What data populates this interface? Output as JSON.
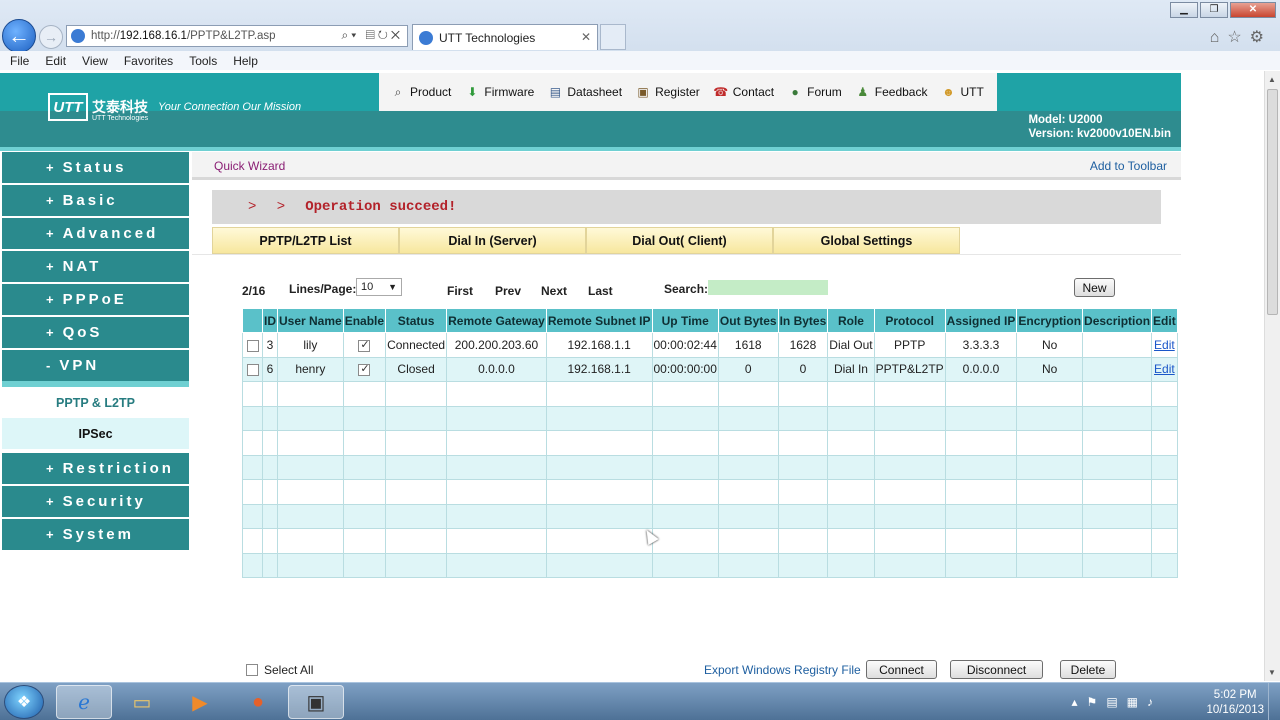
{
  "browser": {
    "url_prefix": "http://",
    "url_host": "192.168.16.1",
    "url_path": "/PPTP&L2TP.asp",
    "tab_title": "UTT Technologies",
    "menu": [
      "File",
      "Edit",
      "View",
      "Favorites",
      "Tools",
      "Help"
    ]
  },
  "header": {
    "logo_mark": "UTT",
    "logo_cn": "艾泰科技",
    "logo_slogan": "Your Connection  Our Mission",
    "logo_sub": "UTT Technologies",
    "toolbar": [
      "Product",
      "Firmware",
      "Datasheet",
      "Register",
      "Contact",
      "Forum",
      "Feedback",
      "UTT"
    ],
    "model": "Model: U2000",
    "version": "Version: kv2000v10EN.bin"
  },
  "sidebar": {
    "items_top": [
      {
        "sign": "+",
        "label": "Status"
      },
      {
        "sign": "+",
        "label": "Basic"
      },
      {
        "sign": "+",
        "label": "Advanced"
      },
      {
        "sign": "+",
        "label": "NAT"
      },
      {
        "sign": "+",
        "label": "PPPoE"
      },
      {
        "sign": "+",
        "label": "QoS"
      },
      {
        "sign": "-",
        "label": "VPN"
      }
    ],
    "sub_items": [
      "PPTP & L2TP",
      "IPSec"
    ],
    "items_bottom": [
      {
        "sign": "+",
        "label": "Restriction"
      },
      {
        "sign": "+",
        "label": "Security"
      },
      {
        "sign": "+",
        "label": "System"
      }
    ]
  },
  "quickbar": {
    "left": "Quick Wizard",
    "right": "Add to Toolbar"
  },
  "message": {
    "arrows": "> >",
    "text": "Operation succeed!"
  },
  "tabs": [
    "PPTP/L2TP List",
    "Dial In (Server)",
    "Dial Out( Client)",
    "Global Settings"
  ],
  "pager": {
    "count": "2/16",
    "lines_label": "Lines/Page:",
    "lines_value": "10",
    "first": "First",
    "prev": "Prev",
    "next": "Next",
    "last": "Last",
    "search_label": "Search:",
    "new_label": "New"
  },
  "table": {
    "columns": [
      "ID",
      "User Name",
      "Enable",
      "Status",
      "Remote Gateway",
      "Remote Subnet IP",
      "Up Time",
      "Out Bytes",
      "In Bytes",
      "Role",
      "Protocol",
      "Assigned IP",
      "Encryption",
      "Description",
      "Edit"
    ],
    "rows": [
      {
        "id": "3",
        "user": "lily",
        "enabled": true,
        "status": "Connected",
        "gateway": "200.200.203.60",
        "subnet": "192.168.1.1",
        "uptime": "00:00:02:44",
        "out": "1618",
        "in": "1628",
        "role": "Dial Out",
        "protocol": "PPTP",
        "assigned": "3.3.3.3",
        "encryption": "No",
        "description": "",
        "edit": "Edit"
      },
      {
        "id": "6",
        "user": "henry",
        "enabled": true,
        "status": "Closed",
        "gateway": "0.0.0.0",
        "subnet": "192.168.1.1",
        "uptime": "00:00:00:00",
        "out": "0",
        "in": "0",
        "role": "Dial In",
        "protocol": "PPTP&L2TP",
        "assigned": "0.0.0.0",
        "encryption": "No",
        "description": "",
        "edit": "Edit"
      }
    ],
    "empty_rows": 8
  },
  "footer": {
    "select_all": "Select All",
    "export": "Export Windows Registry File",
    "connect": "Connect",
    "disconnect": "Disconnect",
    "delete": "Delete"
  },
  "taskbar": {
    "time": "5:02 PM",
    "date": "10/16/2013"
  },
  "colors": {
    "teal": "#2a8a8d",
    "teal_light": "#1fa3a6",
    "header_cell": "#5ac1c9",
    "error_text": "#b3222a"
  }
}
